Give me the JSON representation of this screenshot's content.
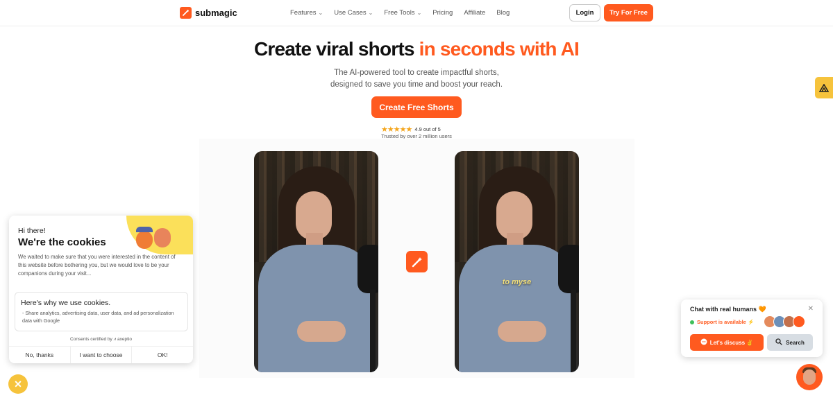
{
  "nav": {
    "brand": "submagic",
    "items": [
      {
        "label": "Features",
        "has_dropdown": true
      },
      {
        "label": "Use Cases",
        "has_dropdown": true
      },
      {
        "label": "Free Tools",
        "has_dropdown": true
      },
      {
        "label": "Pricing",
        "has_dropdown": false
      },
      {
        "label": "Affiliate",
        "has_dropdown": false
      },
      {
        "label": "Blog",
        "has_dropdown": false
      }
    ],
    "login_label": "Login",
    "try_label": "Try For Free"
  },
  "hero": {
    "title_main": "Create viral shorts ",
    "title_accent": "in seconds with AI",
    "subtitle_line1": "The AI-powered tool to create impactful shorts,",
    "subtitle_line2": "designed to save you time and boost your reach.",
    "cta_label": "Create Free Shorts",
    "rating_text": "4.9 out of 5",
    "rating_value": 4.9,
    "trusted_text": "Trusted by over 2 million users"
  },
  "demo": {
    "caption": "to myse"
  },
  "cookie": {
    "greeting": "Hi there!",
    "title": "We're the cookies",
    "text": "We waited to make sure that you were interested in the content of this website before bothering you, but we would love to be your companions during your visit...",
    "why_title": "Here's why we use cookies.",
    "why_text": "- Share analytics, advertising data, user data, and ad personalization data with Google",
    "certified": "Consents certified by ⩘ axeptio",
    "btn_no": "No, thanks",
    "btn_choose": "I want to choose",
    "btn_ok": "OK!"
  },
  "chat": {
    "title": "Chat with real humans 🧡",
    "status": "Support is available ⚡",
    "discuss_label": "Let's discuss ✌",
    "search_label": "Search"
  },
  "colors": {
    "accent": "#ff5a1f",
    "yellow": "#f6c33c",
    "online": "#3fbf5a"
  }
}
